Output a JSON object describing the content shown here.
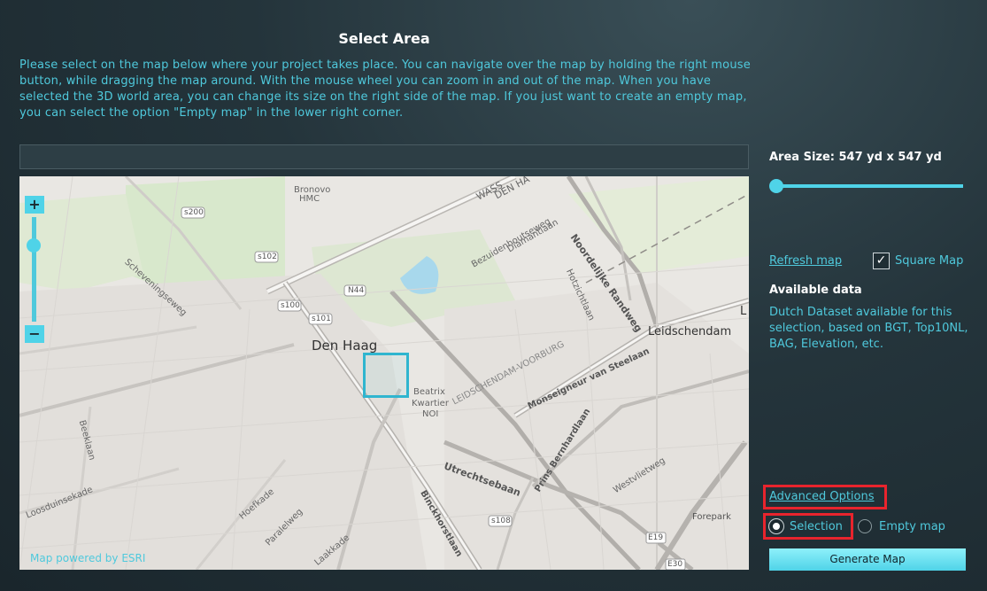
{
  "header": {
    "title": "Select Area"
  },
  "intro": "Please select on the map below where your project takes place. You can navigate over the map by holding the right mouse button, while dragging the map around. With the mouse wheel you can zoom in and out of the map. When you have selected the 3D world area, you can change its size on the right side of the map. If you just want to create an empty map, you can select the option \"Empty map\" in the lower right corner.",
  "search": {
    "value": ""
  },
  "map": {
    "zoom_in": "+",
    "zoom_out": "−",
    "attribution": "Map powered by ESRI",
    "labels": {
      "den_haag": "Den Haag",
      "leidschendam": "Leidschendam",
      "hmc": "HMC",
      "bronovo": "Bronovo",
      "wassenaar": "WASS",
      "den_haag_road": "DEN HA",
      "noordelijke": "Noordelijke Randweg",
      "bezuidenhout": "Bezuidenhoutseweg",
      "diamantlaan": "Diamantlaan",
      "hotzichtlaan": "Hotzichtlaan",
      "scheveningse": "Scheveningseweg",
      "leidschendam_voorburg": "LEIDSCHENDAM-VOORBURG",
      "monseigneur": "Monseigneur van Steelaan",
      "beatrix": "Beatrix",
      "kwartier": "Kwartier",
      "noi": "NOI",
      "utrechtsebaan": "Utrechtsebaan",
      "binckhorstlaan": "Binckhorstlaan",
      "prins": "Prins Bernhardlaan",
      "westvlietweg": "Westvlietweg",
      "forepark": "Forepark",
      "loosduinsekade": "Loosduinsekade",
      "hoefkade": "Hoefkade",
      "laakkade": "Laakkade",
      "paralelweg": "Paralelweg",
      "beeklaan": "Beeklaan",
      "l": "L"
    },
    "shields": {
      "s200": "s200",
      "s102": "s102",
      "n44": "N44",
      "s100": "s100",
      "s101": "s101",
      "s108": "s108",
      "e19": "E19",
      "e30": "E30"
    }
  },
  "sidebar": {
    "area_size_label": "Area Size: 547 yd x 547 yd",
    "area_slider_value": 0.0,
    "refresh_label": "Refresh map",
    "square_check": "✓",
    "square_label": "Square Map",
    "available_title": "Available data",
    "available_text": "Dutch Dataset available for this selection, based on BGT, Top10NL, BAG, Elevation, etc.",
    "advanced_label": "Advanced Options",
    "option_selection": "Selection",
    "option_empty": "Empty map",
    "generate_label": "Generate Map"
  },
  "colors": {
    "accent": "#4fc9dc",
    "highlight": "#e8242d",
    "button": "#4fd3e8"
  }
}
